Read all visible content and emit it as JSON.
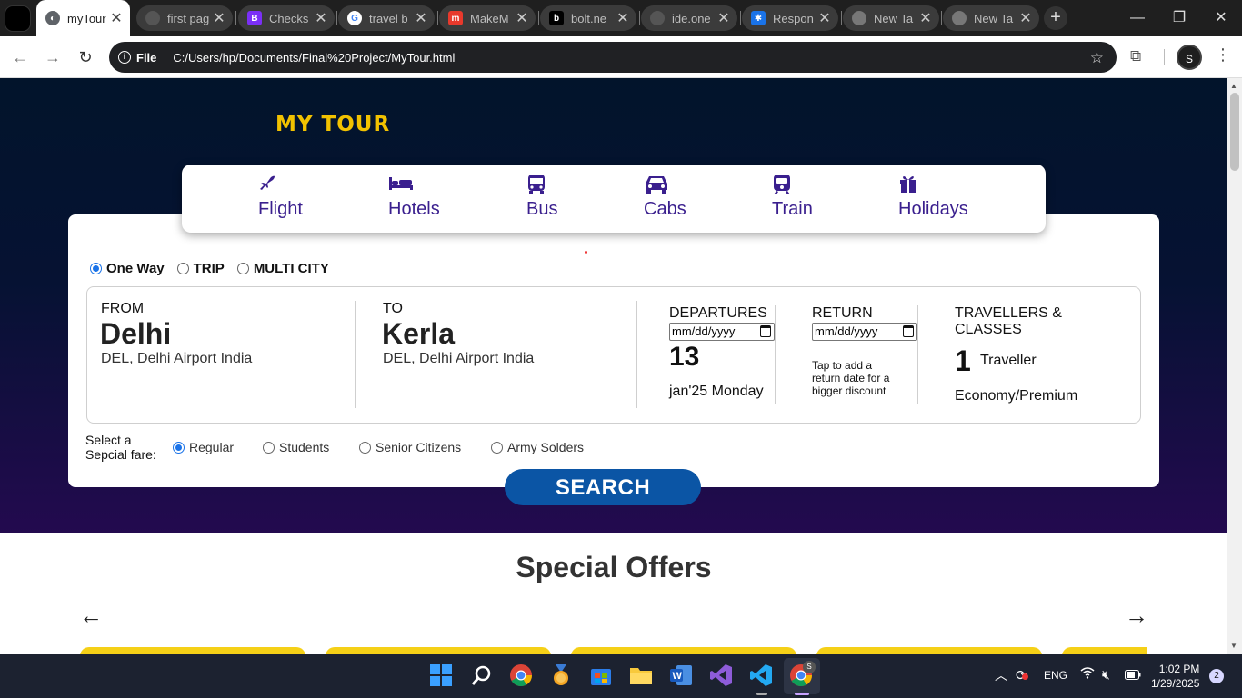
{
  "browser": {
    "tabs": [
      {
        "title": "myTour",
        "active": true
      },
      {
        "title": "first pag"
      },
      {
        "title": "Checks"
      },
      {
        "title": "travel b"
      },
      {
        "title": "MakeM"
      },
      {
        "title": "bolt.ne"
      },
      {
        "title": "ide.one"
      },
      {
        "title": "Respon"
      },
      {
        "title": "New Ta"
      },
      {
        "title": "New Ta"
      }
    ],
    "close_glyph": "✕",
    "new_tab_glyph": "+",
    "url_chip": "File",
    "url": "C:/Users/hp/Documents/Final%20Project/MyTour.html",
    "avatar_letter": "S",
    "window_controls": {
      "minimize": "—",
      "restore": "❐",
      "close": "✕"
    }
  },
  "page": {
    "logo": "MY TOUR",
    "nav": [
      {
        "label": "Flight",
        "icon": "plane-icon"
      },
      {
        "label": "Hotels",
        "icon": "bed-icon"
      },
      {
        "label": "Bus",
        "icon": "bus-icon"
      },
      {
        "label": "Cabs",
        "icon": "car-icon"
      },
      {
        "label": "Train",
        "icon": "train-icon"
      },
      {
        "label": "Holidays",
        "icon": "gift-icon"
      }
    ],
    "trip_options": [
      {
        "label": "One Way",
        "selected": true
      },
      {
        "label": "TRIP",
        "selected": false
      },
      {
        "label": "MULTI CITY",
        "selected": false
      }
    ],
    "from": {
      "label": "FROM",
      "city": "Delhi",
      "detail": "DEL, Delhi Airport India"
    },
    "to": {
      "label": "TO",
      "city": "Kerla",
      "detail": "DEL, Delhi Airport India"
    },
    "departures": {
      "label": "DEPARTURES",
      "placeholder": "mm/dd/yyyy",
      "day": "13",
      "date_text": "jan'25 Monday"
    },
    "return": {
      "label": "RETURN",
      "placeholder": "mm/dd/yyyy",
      "hint": "Tap to add a return date for a bigger discount"
    },
    "travellers": {
      "label": "TRAVELLERS & CLASSES",
      "count": "1",
      "unit": "Traveller",
      "class": "Economy/Premium"
    },
    "fare": {
      "label_line1": "Select a",
      "label_line2": "Sepcial fare:",
      "options": [
        {
          "label": "Regular",
          "selected": true
        },
        {
          "label": "Students",
          "selected": false
        },
        {
          "label": "Senior Citizens",
          "selected": false
        },
        {
          "label": "Army Solders",
          "selected": false
        }
      ]
    },
    "search_label": "SEARCH",
    "offers_title": "Special Offers",
    "prev_arrow": "←",
    "next_arrow": "→"
  },
  "taskbar": {
    "lang": "ENG",
    "time": "1:02 PM",
    "date": "1/29/2025",
    "notifications": "2",
    "chrome_badge": "S"
  },
  "colors": {
    "brand_purple": "#3a1f8e",
    "logo_yellow": "#f2c200",
    "search_blue": "#0b55a5",
    "offer_yellow": "#f5d017"
  }
}
